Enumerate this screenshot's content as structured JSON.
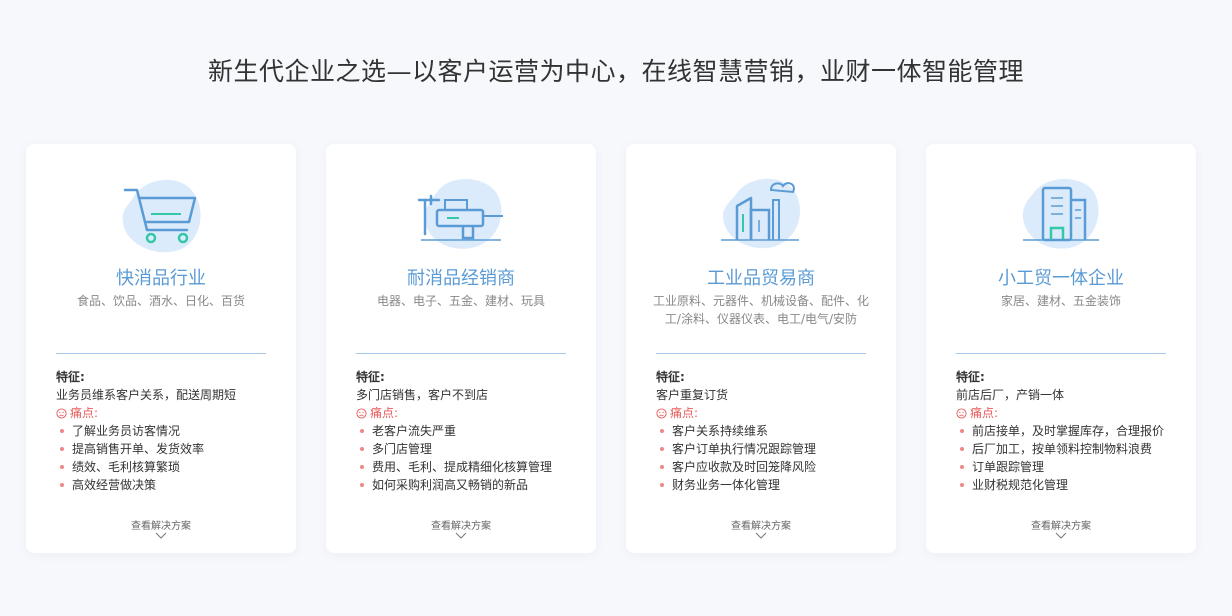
{
  "headline": "新生代企业之选—以客户运营为中心，在线智慧营销，业财一体智能管理",
  "labels": {
    "feature_label": "特征:",
    "pain_label": "痛点:",
    "more_label": "查看解决方案"
  },
  "colors": {
    "accent": "#5b9bd5",
    "pain": "#e85a5a",
    "icon_blob": "#dcebfb",
    "icon_line": "#5b9bd5",
    "icon_accent": "#33c9a6"
  },
  "cards": [
    {
      "icon": "shopping-cart-icon",
      "title": "快消品行业",
      "subtitle": "食品、饮品、酒水、日化、百货",
      "feature": "业务员维系客户关系，配送周期短",
      "pains": [
        "了解业务员访客情况",
        "提高销售开单、发货效率",
        "绩效、毛利核算繁琐",
        "高效经营做决策"
      ]
    },
    {
      "icon": "tools-icon",
      "title": "耐消品经销商",
      "subtitle": "电器、电子、五金、建材、玩具",
      "feature": "多门店销售，客户不到店",
      "pains": [
        "老客户流失严重",
        "多门店管理",
        "费用、毛利、提成精细化核算管理",
        "如何采购利润高又畅销的新品"
      ]
    },
    {
      "icon": "factory-icon",
      "title": "工业品贸易商",
      "subtitle": "工业原料、元器件、机械设备、配件、化工/涂料、仪器仪表、电工/电气/安防",
      "feature": "客户重复订货",
      "pains": [
        "客户关系持续维系",
        "客户订单执行情况跟踪管理",
        "客户应收款及时回笼降风险",
        "财务业务一体化管理"
      ]
    },
    {
      "icon": "building-icon",
      "title": "小工贸一体企业",
      "subtitle": "家居、建材、五金装饰",
      "feature": "前店后厂，产销一体",
      "pains": [
        "前店接单，及时掌握库存，合理报价",
        "后厂加工，按单领料控制物料浪费",
        "订单跟踪管理",
        "业财税规范化管理"
      ]
    }
  ]
}
